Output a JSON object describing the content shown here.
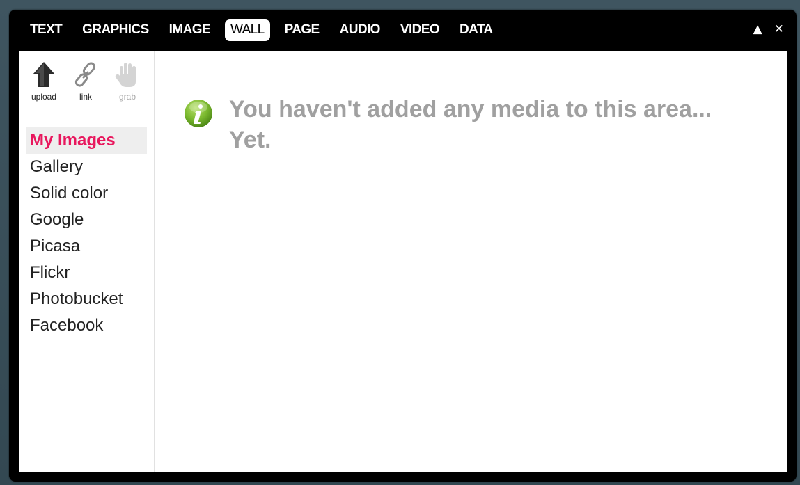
{
  "tabs": [
    {
      "label": "TEXT"
    },
    {
      "label": "GRAPHICS"
    },
    {
      "label": "IMAGE"
    },
    {
      "label": "WALL"
    },
    {
      "label": "PAGE"
    },
    {
      "label": "AUDIO"
    },
    {
      "label": "VIDEO"
    },
    {
      "label": "DATA"
    }
  ],
  "active_tab": "WALL",
  "window": {
    "collapse_icon": "triangle-up",
    "collapse_glyph": "▲",
    "close_icon": "close-x",
    "close_glyph": "✕"
  },
  "tools": {
    "upload": {
      "label": "upload",
      "icon": "upload-arrow"
    },
    "link": {
      "label": "link",
      "icon": "chain-link"
    },
    "grab": {
      "label": "grab",
      "icon": "hand",
      "enabled": false
    }
  },
  "sources": [
    {
      "label": "My Images"
    },
    {
      "label": "Gallery"
    },
    {
      "label": "Solid color"
    },
    {
      "label": "Google"
    },
    {
      "label": "Picasa"
    },
    {
      "label": "Flickr"
    },
    {
      "label": "Photobucket"
    },
    {
      "label": "Facebook"
    }
  ],
  "selected_source": "My Images",
  "notice": {
    "icon": "info",
    "message": "You haven't added any media to this area... Yet."
  },
  "colors": {
    "selected_source": "#e8175d",
    "notice_text": "#a0a0a0",
    "info_icon": "#7ab82e"
  }
}
